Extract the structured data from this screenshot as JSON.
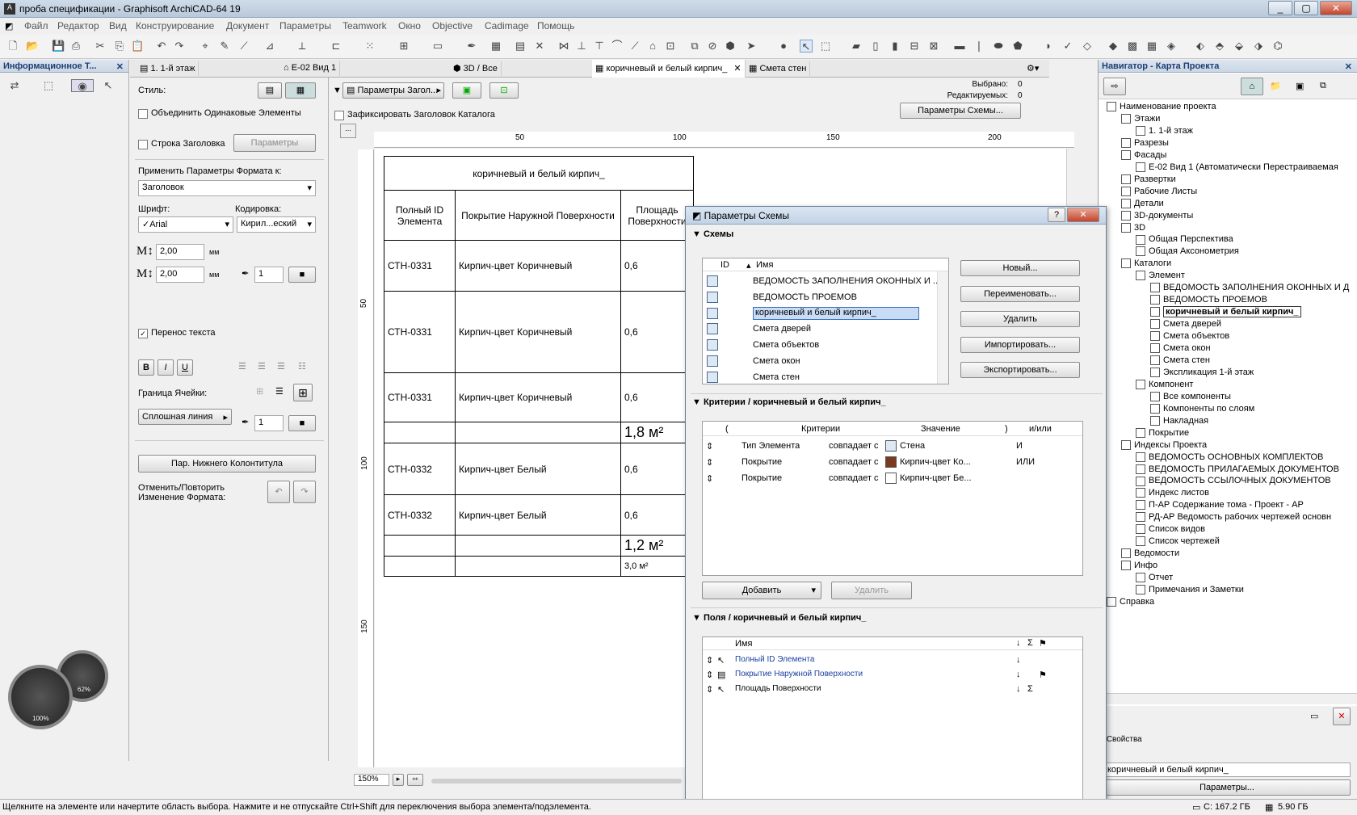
{
  "window": {
    "title": "проба спецификации - Graphisoft ArchiCAD-64 19",
    "min": "_",
    "max": "▢",
    "close": "✕"
  },
  "menu": [
    "Файл",
    "Редактор",
    "Вид",
    "Конструирование",
    "Документ",
    "Параметры",
    "Teamwork",
    "Окно",
    "Objective",
    "Cadimage",
    "Помощь"
  ],
  "left_panel": {
    "title": "Информационное Т...",
    "style_label": "Стиль:",
    "merge_label": "Объединить Одинаковые Элементы",
    "header_row_label": "Строка Заголовка",
    "params_btn": "Параметры",
    "apply_label": "Применить Параметры Формата к:",
    "apply_value": "Заголовок",
    "font_label": "Шрифт:",
    "font_value": "✓Arial",
    "encoding_label": "Кодировка:",
    "encoding_value": "Кирил...еский",
    "size1": "2,00",
    "size2": "2,00",
    "unit": "мм",
    "pen1": "1",
    "pen2": "1",
    "wrap_label": "Перенос текста",
    "bold": "B",
    "italic": "I",
    "underline": "U",
    "border_label": "Граница Ячейки:",
    "line_value": "Сплошная линия",
    "footer_btn": "Пар. Нижнего Колонтитула",
    "undo_label": "Отменить/Повторить\nИзменение Формата:"
  },
  "tabs": [
    "1. 1-й этаж",
    "E-02 Вид 1",
    "3D / Все",
    "коричневый и белый кирпич_",
    "Смета стен"
  ],
  "schedule": {
    "header_btn": "Параметры Загол...",
    "fix_label": "Зафиксировать Заголовок Каталога",
    "selected_label": "Выбрано:",
    "selected_value": "0",
    "editable_label": "Редактируемых:",
    "editable_value": "0",
    "scheme_btn": "Параметры Схемы...",
    "ruler_h": [
      "50",
      "100",
      "150",
      "200"
    ],
    "ruler_v": [
      "50",
      "100",
      "150"
    ],
    "table_title": "коричневый и белый кирпич_",
    "col_headers": [
      "Полный ID Элемента",
      "Покрытие Наружной Поверхности",
      "Площадь Поверхности"
    ],
    "rows": [
      [
        "СТН-0331",
        "Кирпич-цвет Коричневый",
        "0,6"
      ],
      [
        "СТН-0331",
        "Кирпич-цвет Коричневый",
        "0,6"
      ],
      [
        "СТН-0331",
        "Кирпич-цвет Коричневый",
        "0,6"
      ],
      [
        "",
        "",
        "1,8 м²"
      ],
      [
        "СТН-0332",
        "Кирпич-цвет Белый",
        "0,6"
      ],
      [
        "СТН-0332",
        "Кирпич-цвет Белый",
        "0,6"
      ],
      [
        "",
        "",
        "1,2 м²"
      ],
      [
        "",
        "",
        "3,0 м²"
      ]
    ],
    "zoom": "150%"
  },
  "dialog": {
    "title": "Параметры Схемы",
    "help": "?",
    "close": "✕",
    "schemes_section": "Схемы",
    "col_id": "ID",
    "col_name": "Имя",
    "schemes": [
      "ВЕДОМОСТЬ ЗАПОЛНЕНИЯ ОКОННЫХ И ...",
      "ВЕДОМОСТЬ ПРОЕМОВ",
      "коричневый и белый кирпич_",
      "Смета дверей",
      "Смета объектов",
      "Смета окон",
      "Смета стен"
    ],
    "buttons": [
      "Новый...",
      "Переименовать...",
      "Удалить",
      "Импортировать...",
      "Экспортировать..."
    ],
    "criteria_section": "Критерии / коричневый и белый кирпич_",
    "crit_headers": [
      "(",
      "Критерии",
      "Значение",
      ")",
      "и/или"
    ],
    "criteria": [
      {
        "name": "Тип Элемента",
        "op": "совпадает с",
        "value": "Стена",
        "logic": "И"
      },
      {
        "name": "Покрытие",
        "op": "совпадает с",
        "value": "Кирпич-цвет Ко...",
        "logic": "ИЛИ"
      },
      {
        "name": "Покрытие",
        "op": "совпадает с",
        "value": "Кирпич-цвет Бе...",
        "logic": ""
      }
    ],
    "add_btn": "Добавить",
    "delete_btn": "Удалить",
    "fields_section": "Поля / коричневый и белый кирпич_",
    "fields_header": "Имя",
    "fields": [
      "Полный ID Элемента",
      "Покрытие Наружной Поверхности",
      "Площадь Поверхности"
    ]
  },
  "navigator": {
    "title": "Навигатор - Карта Проекта",
    "items": [
      {
        "t": "Наименование проекта",
        "l": 0
      },
      {
        "t": "Этажи",
        "l": 1
      },
      {
        "t": "1. 1-й этаж",
        "l": 2
      },
      {
        "t": "Разрезы",
        "l": 1
      },
      {
        "t": "Фасады",
        "l": 1
      },
      {
        "t": "E-02 Вид 1 (Автоматически Перестраиваемая",
        "l": 2
      },
      {
        "t": "Развертки",
        "l": 1
      },
      {
        "t": "Рабочие Листы",
        "l": 1
      },
      {
        "t": "Детали",
        "l": 1
      },
      {
        "t": "3D-документы",
        "l": 1
      },
      {
        "t": "3D",
        "l": 1
      },
      {
        "t": "Общая Перспектива",
        "l": 2
      },
      {
        "t": "Общая Аксонометрия",
        "l": 2
      },
      {
        "t": "Каталоги",
        "l": 1
      },
      {
        "t": "Элемент",
        "l": 2
      },
      {
        "t": "ВЕДОМОСТЬ ЗАПОЛНЕНИЯ ОКОННЫХ И Д",
        "l": 3
      },
      {
        "t": "ВЕДОМОСТЬ ПРОЕМОВ",
        "l": 3
      },
      {
        "t": "коричневый и белый кирпич_",
        "l": 3,
        "sel": true
      },
      {
        "t": "Смета дверей",
        "l": 3
      },
      {
        "t": "Смета объектов",
        "l": 3
      },
      {
        "t": "Смета окон",
        "l": 3
      },
      {
        "t": "Смета стен",
        "l": 3
      },
      {
        "t": "Экспликация 1-й этаж",
        "l": 3
      },
      {
        "t": "Компонент",
        "l": 2
      },
      {
        "t": "Все компоненты",
        "l": 3
      },
      {
        "t": "Компоненты по слоям",
        "l": 3
      },
      {
        "t": "Накладная",
        "l": 3
      },
      {
        "t": "Покрытие",
        "l": 2
      },
      {
        "t": "Индексы Проекта",
        "l": 1
      },
      {
        "t": "ВЕДОМОСТЬ ОСНОВНЫХ КОМПЛЕКТОВ",
        "l": 2
      },
      {
        "t": "ВЕДОМОСТЬ ПРИЛАГАЕМЫХ ДОКУМЕНТОВ",
        "l": 2
      },
      {
        "t": "ВЕДОМОСТЬ ССЫЛОЧНЫХ ДОКУМЕНТОВ",
        "l": 2
      },
      {
        "t": "Индекс листов",
        "l": 2
      },
      {
        "t": "П-АР Содержание тома - Проект - АР",
        "l": 2
      },
      {
        "t": "РД-АР Ведомость рабочих чертежей основн",
        "l": 2
      },
      {
        "t": "Список видов",
        "l": 2
      },
      {
        "t": "Список чертежей",
        "l": 2
      },
      {
        "t": "Ведомости",
        "l": 1
      },
      {
        "t": "Инфо",
        "l": 1
      },
      {
        "t": "Отчет",
        "l": 2
      },
      {
        "t": "Примечания и Заметки",
        "l": 2
      },
      {
        "t": "Справка",
        "l": 0
      }
    ],
    "props_label": "Свойства",
    "props_value": "коричневый и белый кирпич_",
    "params_btn": "Параметры..."
  },
  "gauges": {
    "a": "100%",
    "b": "62%"
  },
  "status": {
    "hint": "Щелкните на элементе или начертите область выбора. Нажмите и не отпускайте Ctrl+Shift для переключения выбора элемента/подэлемента.",
    "disk": "C: 167.2 ГБ",
    "mem": "5.90 ГБ"
  }
}
